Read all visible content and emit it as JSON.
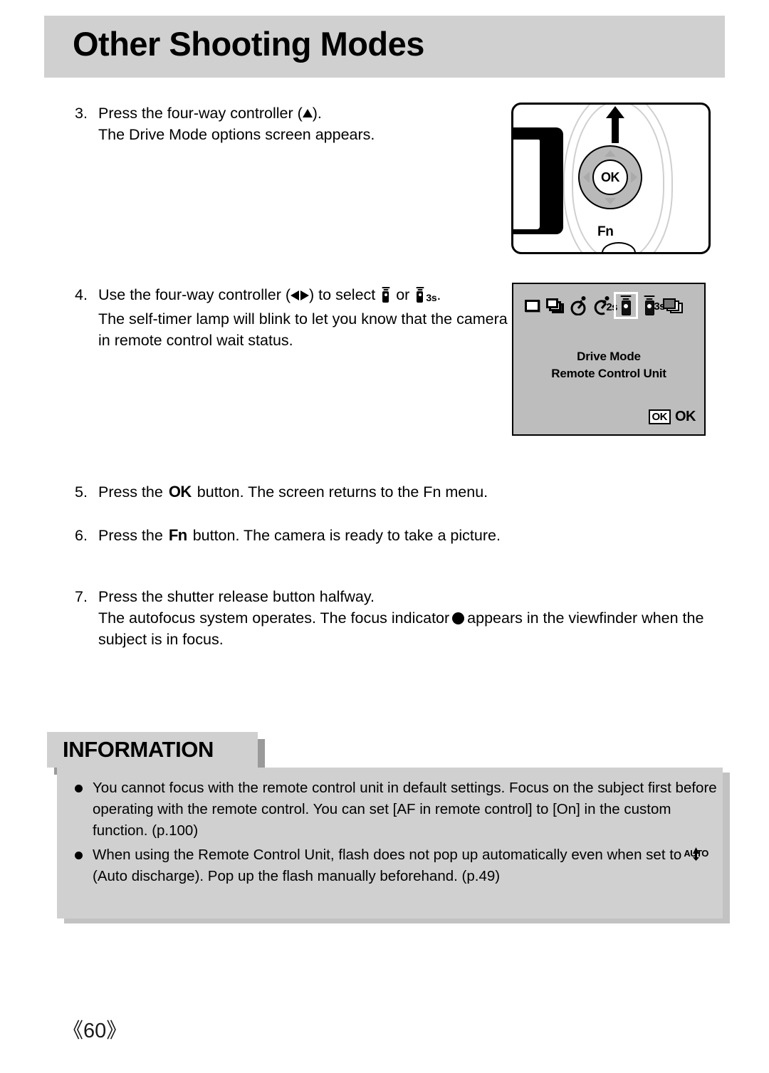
{
  "header": {
    "title": "Other Shooting Modes"
  },
  "steps": [
    {
      "number": "3.",
      "lines": [
        {
          "pre": "Press the four-way controller (",
          "icon": "triangle-up-icon",
          "post": ")."
        },
        {
          "pre": "The Drive Mode options screen appears.",
          "icon": null,
          "post": ""
        }
      ]
    },
    {
      "number": "4.",
      "lines": [
        {
          "pre": "Use the four-way controller (",
          "icon": "triangle-left-right-icon",
          "post": ") to select",
          "mid": "or",
          "end": "."
        },
        {
          "pre": "The self-timer lamp will blink to let you know that the camera is",
          "icon": null,
          "post": ""
        },
        {
          "pre": "in remote control wait status.",
          "icon": null,
          "post": ""
        }
      ]
    },
    {
      "number": "5.",
      "lines": [
        {
          "pre": "Press the",
          "button": "OK",
          "post": "button. The screen returns to the Fn menu."
        }
      ]
    },
    {
      "number": "6.",
      "lines": [
        {
          "pre": "Press the",
          "button": "Fn",
          "post": "button. The camera is ready to take a picture."
        }
      ]
    },
    {
      "number": "7.",
      "lines": [
        {
          "pre": "Press the shutter release button halfway.",
          "icon": null,
          "post": ""
        },
        {
          "pre": "The autofocus system operates. The focus indicator",
          "icon": "focus-dot-icon",
          "post": "appears in the viewfinder when the"
        },
        {
          "pre": "subject is in focus.",
          "icon": null,
          "post": ""
        }
      ]
    }
  ],
  "step3_text": {
    "line1_pre": "Press the four-way controller (",
    "line1_post": ").",
    "line2": "The Drive Mode options screen appears."
  },
  "step4_text": {
    "line1_pre": "Use the four-way controller (",
    "line1_mid": ") to select",
    "line1_or": "or",
    "line1_end": ".",
    "remote_sub": "3s",
    "line2": "The self-timer lamp will blink to let you know that the camera is",
    "line3": "in remote control wait status."
  },
  "step5_text": {
    "pre": "Press the",
    "button": "OK",
    "post": "button. The screen returns to the Fn menu."
  },
  "step6_text": {
    "pre": "Press the",
    "button": "Fn",
    "post": "button. The camera is ready to take a picture."
  },
  "step7_text": {
    "line1": "Press the shutter release button halfway.",
    "line2_pre": "The autofocus system operates. The focus indicator",
    "line2_post": "appears in the viewfinder when the",
    "line3": "subject is in focus."
  },
  "camera_illustration": {
    "ok_button_label": "OK",
    "fn_button_label": "Fn"
  },
  "lcd_screen": {
    "icons": [
      {
        "name": "single-frame-icon",
        "label": "",
        "selected": false
      },
      {
        "name": "continuous-shooting-icon",
        "label": "",
        "selected": false
      },
      {
        "name": "self-timer-icon",
        "label": "",
        "selected": false
      },
      {
        "name": "self-timer-2s-icon",
        "label": "2s",
        "selected": false
      },
      {
        "name": "remote-control-icon",
        "label": "",
        "selected": true
      },
      {
        "name": "remote-control-3s-icon",
        "label": "3s",
        "selected": false
      },
      {
        "name": "exposure-bracketing-icon",
        "label": "",
        "selected": false
      }
    ],
    "title_line1": "Drive Mode",
    "title_line2": "Remote Control Unit",
    "ok_box": "OK",
    "ok_text": "OK"
  },
  "information": {
    "heading": "INFORMATION",
    "items": [
      {
        "lines": [
          "You cannot focus with the remote control unit in default settings. Focus on the subject first before",
          "operating with the remote control. You can set [AF in remote control] to [On] in the custom",
          "function. (p.100)"
        ],
        "inline_icon": null
      },
      {
        "lines": [
          "When using the Remote Control Unit, flash does not pop up automatically even when set to",
          "(Auto discharge). Pop up the flash manually beforehand. (p.49)"
        ],
        "inline_icon": "auto-flash-icon",
        "auto_icon_label": "AUTO"
      }
    ]
  },
  "footer": {
    "page_number": "《60》"
  },
  "colors": {
    "header_band": "#d0d0d0",
    "info_box": "#d0d0d0",
    "info_shadow": "#9a9a9a",
    "lcd_background": "#bdbdbd",
    "dpad_ring": "#b9b9b9",
    "text": "#000000"
  }
}
